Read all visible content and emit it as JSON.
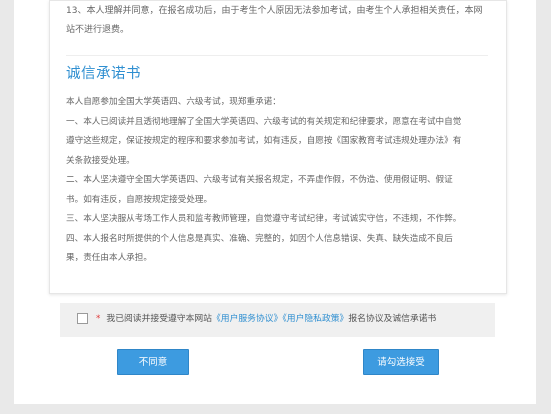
{
  "clause_13": "13、本人理解并同意，在报名成功后，由于考生个人原因无法参加考试，由考生个人承担相关责任，本网站不进行退费。",
  "pledge": {
    "title": "诚信承诺书",
    "lines": [
      "本人自愿参加全国大学英语四、六级考试，现郑重承诺：",
      "一、本人已阅读并且透彻地理解了全国大学英语四、六级考试的有关规定和纪律要求，愿意在考试中自觉",
      "遵守这些规定，保证按规定的程序和要求参加考试，如有违反，自愿按《国家教育考试违规处理办法》有",
      "关条款接受处理。",
      "二、本人坚决遵守全国大学英语四、六级考试有关报名规定，不弄虚作假，不伪造、使用假证明、假证",
      "书。如有违反，自愿按规定接受处理。",
      "三、本人坚决服从考场工作人员和监考教师管理，自觉遵守考试纪律，考试诚实守信，不违规，不作弊。",
      "四、本人报名时所提供的个人信息是真实、准确、完整的，如因个人信息错误、失真、缺失造成不良后",
      "果，责任由本人承担。"
    ]
  },
  "agreement": {
    "required_mark": "*",
    "prefix": "我已阅读并接受遵守本网站",
    "service_link": "《用户服务协议》",
    "privacy_link": "《用户隐私政策》",
    "suffix": "报名协议及诚信承诺书"
  },
  "buttons": {
    "decline": "不同意",
    "accept": "请勾选接受"
  },
  "colors": {
    "accent": "#2f8fd1",
    "button": "#3d9be0",
    "required": "#e03a3a"
  }
}
